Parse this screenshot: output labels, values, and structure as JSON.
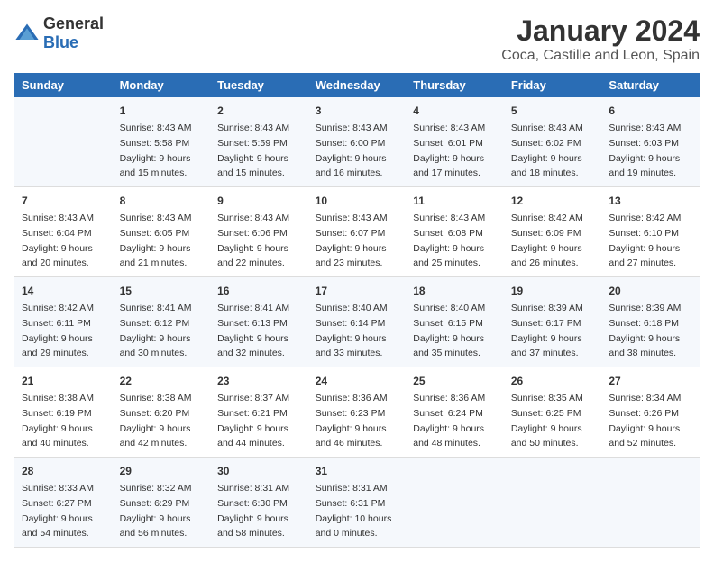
{
  "logo": {
    "general": "General",
    "blue": "Blue"
  },
  "title": "January 2024",
  "subtitle": "Coca, Castille and Leon, Spain",
  "days_of_week": [
    "Sunday",
    "Monday",
    "Tuesday",
    "Wednesday",
    "Thursday",
    "Friday",
    "Saturday"
  ],
  "weeks": [
    [
      {
        "day": "",
        "sunrise": "",
        "sunset": "",
        "daylight": ""
      },
      {
        "day": "1",
        "sunrise": "Sunrise: 8:43 AM",
        "sunset": "Sunset: 5:58 PM",
        "daylight": "Daylight: 9 hours and 15 minutes."
      },
      {
        "day": "2",
        "sunrise": "Sunrise: 8:43 AM",
        "sunset": "Sunset: 5:59 PM",
        "daylight": "Daylight: 9 hours and 15 minutes."
      },
      {
        "day": "3",
        "sunrise": "Sunrise: 8:43 AM",
        "sunset": "Sunset: 6:00 PM",
        "daylight": "Daylight: 9 hours and 16 minutes."
      },
      {
        "day": "4",
        "sunrise": "Sunrise: 8:43 AM",
        "sunset": "Sunset: 6:01 PM",
        "daylight": "Daylight: 9 hours and 17 minutes."
      },
      {
        "day": "5",
        "sunrise": "Sunrise: 8:43 AM",
        "sunset": "Sunset: 6:02 PM",
        "daylight": "Daylight: 9 hours and 18 minutes."
      },
      {
        "day": "6",
        "sunrise": "Sunrise: 8:43 AM",
        "sunset": "Sunset: 6:03 PM",
        "daylight": "Daylight: 9 hours and 19 minutes."
      }
    ],
    [
      {
        "day": "7",
        "sunrise": "Sunrise: 8:43 AM",
        "sunset": "Sunset: 6:04 PM",
        "daylight": "Daylight: 9 hours and 20 minutes."
      },
      {
        "day": "8",
        "sunrise": "Sunrise: 8:43 AM",
        "sunset": "Sunset: 6:05 PM",
        "daylight": "Daylight: 9 hours and 21 minutes."
      },
      {
        "day": "9",
        "sunrise": "Sunrise: 8:43 AM",
        "sunset": "Sunset: 6:06 PM",
        "daylight": "Daylight: 9 hours and 22 minutes."
      },
      {
        "day": "10",
        "sunrise": "Sunrise: 8:43 AM",
        "sunset": "Sunset: 6:07 PM",
        "daylight": "Daylight: 9 hours and 23 minutes."
      },
      {
        "day": "11",
        "sunrise": "Sunrise: 8:43 AM",
        "sunset": "Sunset: 6:08 PM",
        "daylight": "Daylight: 9 hours and 25 minutes."
      },
      {
        "day": "12",
        "sunrise": "Sunrise: 8:42 AM",
        "sunset": "Sunset: 6:09 PM",
        "daylight": "Daylight: 9 hours and 26 minutes."
      },
      {
        "day": "13",
        "sunrise": "Sunrise: 8:42 AM",
        "sunset": "Sunset: 6:10 PM",
        "daylight": "Daylight: 9 hours and 27 minutes."
      }
    ],
    [
      {
        "day": "14",
        "sunrise": "Sunrise: 8:42 AM",
        "sunset": "Sunset: 6:11 PM",
        "daylight": "Daylight: 9 hours and 29 minutes."
      },
      {
        "day": "15",
        "sunrise": "Sunrise: 8:41 AM",
        "sunset": "Sunset: 6:12 PM",
        "daylight": "Daylight: 9 hours and 30 minutes."
      },
      {
        "day": "16",
        "sunrise": "Sunrise: 8:41 AM",
        "sunset": "Sunset: 6:13 PM",
        "daylight": "Daylight: 9 hours and 32 minutes."
      },
      {
        "day": "17",
        "sunrise": "Sunrise: 8:40 AM",
        "sunset": "Sunset: 6:14 PM",
        "daylight": "Daylight: 9 hours and 33 minutes."
      },
      {
        "day": "18",
        "sunrise": "Sunrise: 8:40 AM",
        "sunset": "Sunset: 6:15 PM",
        "daylight": "Daylight: 9 hours and 35 minutes."
      },
      {
        "day": "19",
        "sunrise": "Sunrise: 8:39 AM",
        "sunset": "Sunset: 6:17 PM",
        "daylight": "Daylight: 9 hours and 37 minutes."
      },
      {
        "day": "20",
        "sunrise": "Sunrise: 8:39 AM",
        "sunset": "Sunset: 6:18 PM",
        "daylight": "Daylight: 9 hours and 38 minutes."
      }
    ],
    [
      {
        "day": "21",
        "sunrise": "Sunrise: 8:38 AM",
        "sunset": "Sunset: 6:19 PM",
        "daylight": "Daylight: 9 hours and 40 minutes."
      },
      {
        "day": "22",
        "sunrise": "Sunrise: 8:38 AM",
        "sunset": "Sunset: 6:20 PM",
        "daylight": "Daylight: 9 hours and 42 minutes."
      },
      {
        "day": "23",
        "sunrise": "Sunrise: 8:37 AM",
        "sunset": "Sunset: 6:21 PM",
        "daylight": "Daylight: 9 hours and 44 minutes."
      },
      {
        "day": "24",
        "sunrise": "Sunrise: 8:36 AM",
        "sunset": "Sunset: 6:23 PM",
        "daylight": "Daylight: 9 hours and 46 minutes."
      },
      {
        "day": "25",
        "sunrise": "Sunrise: 8:36 AM",
        "sunset": "Sunset: 6:24 PM",
        "daylight": "Daylight: 9 hours and 48 minutes."
      },
      {
        "day": "26",
        "sunrise": "Sunrise: 8:35 AM",
        "sunset": "Sunset: 6:25 PM",
        "daylight": "Daylight: 9 hours and 50 minutes."
      },
      {
        "day": "27",
        "sunrise": "Sunrise: 8:34 AM",
        "sunset": "Sunset: 6:26 PM",
        "daylight": "Daylight: 9 hours and 52 minutes."
      }
    ],
    [
      {
        "day": "28",
        "sunrise": "Sunrise: 8:33 AM",
        "sunset": "Sunset: 6:27 PM",
        "daylight": "Daylight: 9 hours and 54 minutes."
      },
      {
        "day": "29",
        "sunrise": "Sunrise: 8:32 AM",
        "sunset": "Sunset: 6:29 PM",
        "daylight": "Daylight: 9 hours and 56 minutes."
      },
      {
        "day": "30",
        "sunrise": "Sunrise: 8:31 AM",
        "sunset": "Sunset: 6:30 PM",
        "daylight": "Daylight: 9 hours and 58 minutes."
      },
      {
        "day": "31",
        "sunrise": "Sunrise: 8:31 AM",
        "sunset": "Sunset: 6:31 PM",
        "daylight": "Daylight: 10 hours and 0 minutes."
      },
      {
        "day": "",
        "sunrise": "",
        "sunset": "",
        "daylight": ""
      },
      {
        "day": "",
        "sunrise": "",
        "sunset": "",
        "daylight": ""
      },
      {
        "day": "",
        "sunrise": "",
        "sunset": "",
        "daylight": ""
      }
    ]
  ]
}
